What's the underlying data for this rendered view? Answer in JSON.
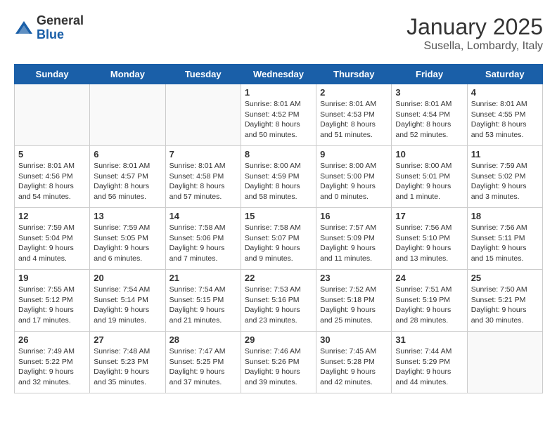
{
  "header": {
    "logo_general": "General",
    "logo_blue": "Blue",
    "title": "January 2025",
    "subtitle": "Susella, Lombardy, Italy"
  },
  "weekdays": [
    "Sunday",
    "Monday",
    "Tuesday",
    "Wednesday",
    "Thursday",
    "Friday",
    "Saturday"
  ],
  "weeks": [
    [
      {
        "day": "",
        "info": ""
      },
      {
        "day": "",
        "info": ""
      },
      {
        "day": "",
        "info": ""
      },
      {
        "day": "1",
        "info": "Sunrise: 8:01 AM\nSunset: 4:52 PM\nDaylight: 8 hours\nand 50 minutes."
      },
      {
        "day": "2",
        "info": "Sunrise: 8:01 AM\nSunset: 4:53 PM\nDaylight: 8 hours\nand 51 minutes."
      },
      {
        "day": "3",
        "info": "Sunrise: 8:01 AM\nSunset: 4:54 PM\nDaylight: 8 hours\nand 52 minutes."
      },
      {
        "day": "4",
        "info": "Sunrise: 8:01 AM\nSunset: 4:55 PM\nDaylight: 8 hours\nand 53 minutes."
      }
    ],
    [
      {
        "day": "5",
        "info": "Sunrise: 8:01 AM\nSunset: 4:56 PM\nDaylight: 8 hours\nand 54 minutes."
      },
      {
        "day": "6",
        "info": "Sunrise: 8:01 AM\nSunset: 4:57 PM\nDaylight: 8 hours\nand 56 minutes."
      },
      {
        "day": "7",
        "info": "Sunrise: 8:01 AM\nSunset: 4:58 PM\nDaylight: 8 hours\nand 57 minutes."
      },
      {
        "day": "8",
        "info": "Sunrise: 8:00 AM\nSunset: 4:59 PM\nDaylight: 8 hours\nand 58 minutes."
      },
      {
        "day": "9",
        "info": "Sunrise: 8:00 AM\nSunset: 5:00 PM\nDaylight: 9 hours\nand 0 minutes."
      },
      {
        "day": "10",
        "info": "Sunrise: 8:00 AM\nSunset: 5:01 PM\nDaylight: 9 hours\nand 1 minute."
      },
      {
        "day": "11",
        "info": "Sunrise: 7:59 AM\nSunset: 5:02 PM\nDaylight: 9 hours\nand 3 minutes."
      }
    ],
    [
      {
        "day": "12",
        "info": "Sunrise: 7:59 AM\nSunset: 5:04 PM\nDaylight: 9 hours\nand 4 minutes."
      },
      {
        "day": "13",
        "info": "Sunrise: 7:59 AM\nSunset: 5:05 PM\nDaylight: 9 hours\nand 6 minutes."
      },
      {
        "day": "14",
        "info": "Sunrise: 7:58 AM\nSunset: 5:06 PM\nDaylight: 9 hours\nand 7 minutes."
      },
      {
        "day": "15",
        "info": "Sunrise: 7:58 AM\nSunset: 5:07 PM\nDaylight: 9 hours\nand 9 minutes."
      },
      {
        "day": "16",
        "info": "Sunrise: 7:57 AM\nSunset: 5:09 PM\nDaylight: 9 hours\nand 11 minutes."
      },
      {
        "day": "17",
        "info": "Sunrise: 7:56 AM\nSunset: 5:10 PM\nDaylight: 9 hours\nand 13 minutes."
      },
      {
        "day": "18",
        "info": "Sunrise: 7:56 AM\nSunset: 5:11 PM\nDaylight: 9 hours\nand 15 minutes."
      }
    ],
    [
      {
        "day": "19",
        "info": "Sunrise: 7:55 AM\nSunset: 5:12 PM\nDaylight: 9 hours\nand 17 minutes."
      },
      {
        "day": "20",
        "info": "Sunrise: 7:54 AM\nSunset: 5:14 PM\nDaylight: 9 hours\nand 19 minutes."
      },
      {
        "day": "21",
        "info": "Sunrise: 7:54 AM\nSunset: 5:15 PM\nDaylight: 9 hours\nand 21 minutes."
      },
      {
        "day": "22",
        "info": "Sunrise: 7:53 AM\nSunset: 5:16 PM\nDaylight: 9 hours\nand 23 minutes."
      },
      {
        "day": "23",
        "info": "Sunrise: 7:52 AM\nSunset: 5:18 PM\nDaylight: 9 hours\nand 25 minutes."
      },
      {
        "day": "24",
        "info": "Sunrise: 7:51 AM\nSunset: 5:19 PM\nDaylight: 9 hours\nand 28 minutes."
      },
      {
        "day": "25",
        "info": "Sunrise: 7:50 AM\nSunset: 5:21 PM\nDaylight: 9 hours\nand 30 minutes."
      }
    ],
    [
      {
        "day": "26",
        "info": "Sunrise: 7:49 AM\nSunset: 5:22 PM\nDaylight: 9 hours\nand 32 minutes."
      },
      {
        "day": "27",
        "info": "Sunrise: 7:48 AM\nSunset: 5:23 PM\nDaylight: 9 hours\nand 35 minutes."
      },
      {
        "day": "28",
        "info": "Sunrise: 7:47 AM\nSunset: 5:25 PM\nDaylight: 9 hours\nand 37 minutes."
      },
      {
        "day": "29",
        "info": "Sunrise: 7:46 AM\nSunset: 5:26 PM\nDaylight: 9 hours\nand 39 minutes."
      },
      {
        "day": "30",
        "info": "Sunrise: 7:45 AM\nSunset: 5:28 PM\nDaylight: 9 hours\nand 42 minutes."
      },
      {
        "day": "31",
        "info": "Sunrise: 7:44 AM\nSunset: 5:29 PM\nDaylight: 9 hours\nand 44 minutes."
      },
      {
        "day": "",
        "info": ""
      }
    ]
  ]
}
